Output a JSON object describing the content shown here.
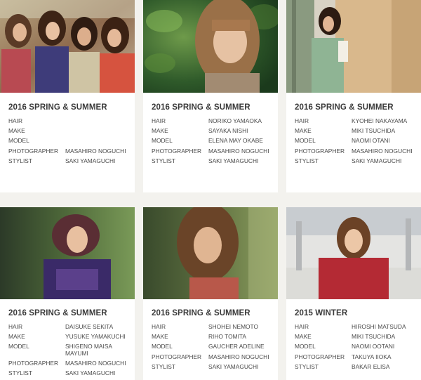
{
  "cards": [
    {
      "title": "2016 SPRING & SUMMER",
      "credits": [
        {
          "role": "HAIR",
          "name": ""
        },
        {
          "role": "MAKE",
          "name": ""
        },
        {
          "role": "MODEL",
          "name": ""
        },
        {
          "role": "PHOTOGRAPHER",
          "name": "MASAHIRO NOGUCHI"
        },
        {
          "role": "STYLIST",
          "name": "SAKI YAMAGUCHI"
        }
      ]
    },
    {
      "title": "2016 SPRING & SUMMER",
      "credits": [
        {
          "role": "HAIR",
          "name": "NORIKO YAMAOKA"
        },
        {
          "role": "MAKE",
          "name": "SAYAKA NISHI"
        },
        {
          "role": "MODEL",
          "name": "ELENA MAY OKABE"
        },
        {
          "role": "PHOTOGRAPHER",
          "name": "MASAHIRO NOGUCHI"
        },
        {
          "role": "STYLIST",
          "name": "SAKI YAMAGUCHI"
        }
      ]
    },
    {
      "title": "2016 SPRING & SUMMER",
      "credits": [
        {
          "role": "HAIR",
          "name": "KYOHEI NAKAYAMA"
        },
        {
          "role": "MAKE",
          "name": "MIKI TSUCHIDA"
        },
        {
          "role": "MODEL",
          "name": "NAOMI OTANI"
        },
        {
          "role": "PHOTOGRAPHER",
          "name": "MASAHIRO NOGUCHI"
        },
        {
          "role": "STYLIST",
          "name": "SAKI YAMAGUCHI"
        }
      ]
    },
    {
      "title": "2016 SPRING & SUMMER",
      "credits": [
        {
          "role": "HAIR",
          "name": "DAISUKE SEKITA"
        },
        {
          "role": "MAKE",
          "name": "YUSUKE YAMAKUCHI"
        },
        {
          "role": "MODEL",
          "name": "SHIGENO MAISA MAYUMI"
        },
        {
          "role": "PHOTOGRAPHER",
          "name": "MASAHIRO NOGUCHI"
        },
        {
          "role": "STYLIST",
          "name": "SAKI YAMAGUCHI"
        }
      ]
    },
    {
      "title": "2016 SPRING & SUMMER",
      "credits": [
        {
          "role": "HAIR",
          "name": "SHOHEI NEMOTO"
        },
        {
          "role": "MAKE",
          "name": "RIHO TOMITA"
        },
        {
          "role": "MODEL",
          "name": "GAUCHER ADELINE"
        },
        {
          "role": "PHOTOGRAPHER",
          "name": "MASAHIRO NOGUCHI"
        },
        {
          "role": "STYLIST",
          "name": "SAKI YAMAGUCHI"
        }
      ]
    },
    {
      "title": "2015 WINTER",
      "credits": [
        {
          "role": "HAIR",
          "name": "HIROSHI MATSUDA"
        },
        {
          "role": "MAKE",
          "name": "MIKI TSUCHIDA"
        },
        {
          "role": "MODEL",
          "name": "NAOMI OOTANI"
        },
        {
          "role": "PHOTOGRAPHER",
          "name": "TAKUYA IIOKA"
        },
        {
          "role": "STYLIST",
          "name": "BAKAR ELISA"
        }
      ]
    }
  ],
  "colors": {
    "page_background": "#f3f2ee",
    "card_background": "#ffffff",
    "title_text": "#3a3a3a",
    "credit_text": "#4a4a4a"
  }
}
